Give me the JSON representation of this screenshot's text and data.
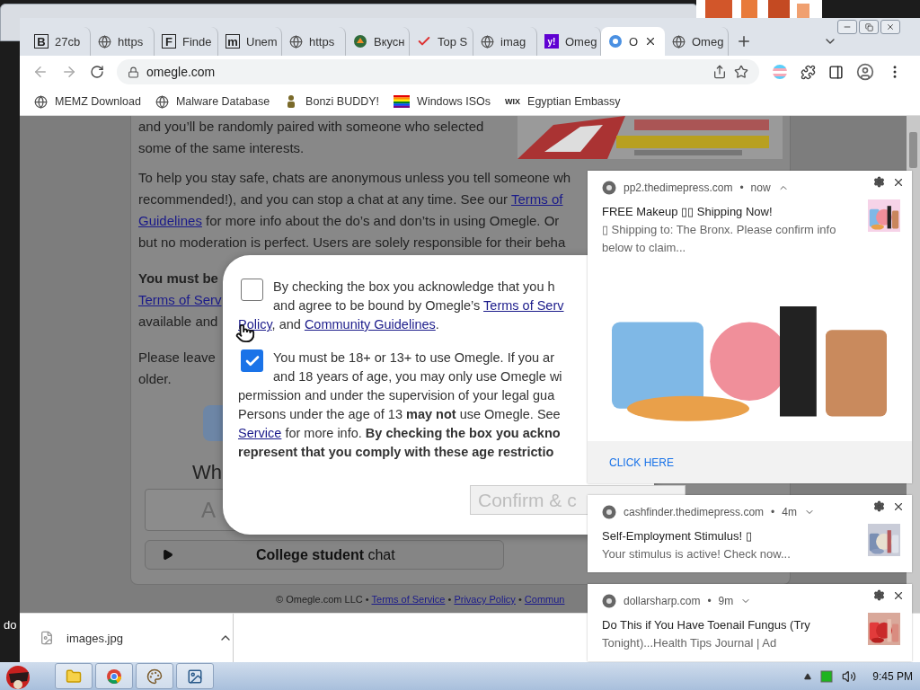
{
  "desktop": {
    "label": "do"
  },
  "browser": {
    "tabs": [
      {
        "icon": {
          "kind": "letter",
          "glyph": "B"
        },
        "title": "27cb",
        "selected": false
      },
      {
        "icon": {
          "kind": "globe"
        },
        "title": "https",
        "selected": false
      },
      {
        "icon": {
          "kind": "letter",
          "glyph": "F"
        },
        "title": "Finde",
        "selected": false
      },
      {
        "icon": {
          "kind": "letter",
          "glyph": "m"
        },
        "title": "Unem",
        "selected": false
      },
      {
        "icon": {
          "kind": "globe"
        },
        "title": "https",
        "selected": false
      },
      {
        "icon": {
          "kind": "dot"
        },
        "title": "Вкусн",
        "selected": false
      },
      {
        "icon": {
          "kind": "check"
        },
        "title": "Top S",
        "selected": false
      },
      {
        "icon": {
          "kind": "globe"
        },
        "title": "imag",
        "selected": false
      },
      {
        "icon": {
          "kind": "tile",
          "glyph": "y!"
        },
        "title": "Omeg",
        "selected": false
      },
      {
        "icon": {
          "kind": "app"
        },
        "title": "O",
        "selected": true
      },
      {
        "icon": {
          "kind": "globe"
        },
        "title": "Omeg",
        "selected": false
      }
    ],
    "address": "omegle.com",
    "bookmarks": [
      {
        "icon": {
          "kind": "globe"
        },
        "label": "MEMZ Download"
      },
      {
        "icon": {
          "kind": "globe"
        },
        "label": "Malware Database"
      },
      {
        "icon": {
          "kind": "figure"
        },
        "label": "Bonzi BUDDY!"
      },
      {
        "icon": {
          "kind": "rainbow"
        },
        "label": "Windows ISOs"
      },
      {
        "icon": {
          "kind": "wordmark",
          "glyph": "WIX"
        },
        "label": "Egyptian Embassy"
      }
    ]
  },
  "page": {
    "intro_lines": [
      [
        {
          "text": "and you’ll be randomly paired with someone who selected",
          "kind": "plain"
        }
      ],
      [
        {
          "text": "some of the same interests.",
          "kind": "plain"
        }
      ]
    ],
    "safety_lines": [
      [
        {
          "text": "To help you stay safe, chats are anonymous unless you tell someone wh",
          "kind": "plain"
        }
      ],
      [
        {
          "text": "recommended!), and you can stop a chat at any time. See our ",
          "kind": "plain"
        },
        {
          "text": "Terms of",
          "kind": "link"
        }
      ],
      [
        {
          "text": "Guidelines",
          "kind": "link"
        },
        {
          "text": " for more info about the do’s and don’ts in using Omegle. Or",
          "kind": "plain"
        }
      ],
      [
        {
          "text": "but no moderation is perfect. Users are solely responsible for their beha",
          "kind": "plain"
        }
      ]
    ],
    "age_lines": [
      [
        {
          "text": "You must be",
          "kind": "bold"
        }
      ],
      [
        {
          "text": "Terms of Serv",
          "kind": "link"
        }
      ],
      [
        {
          "text": "available and",
          "kind": "plain"
        }
      ]
    ],
    "leave_lines": [
      [
        {
          "text": "Please leave",
          "kind": "plain"
        }
      ],
      [
        {
          "text": "older.",
          "kind": "plain"
        }
      ]
    ],
    "heading": "Wh",
    "interests_placeholder": "A",
    "college_button": "**College student** chat",
    "footer": [
      {
        "text": "© Omegle.com LLC • ",
        "kind": "plain"
      },
      {
        "text": "Terms of Service",
        "kind": "link"
      },
      {
        "text": " • ",
        "kind": "plain"
      },
      {
        "text": "Privacy Policy",
        "kind": "link"
      },
      {
        "text": " • ",
        "kind": "plain"
      },
      {
        "text": "Commun",
        "kind": "link"
      }
    ]
  },
  "modal": {
    "items": [
      {
        "checked": false,
        "lines": [
          [
            {
              "text": "By checking the box you acknowledge that you h",
              "kind": "plain"
            }
          ],
          [
            {
              "text": "and agree to be bound by Omegle’s ",
              "kind": "plain"
            },
            {
              "text": "Terms of Serv",
              "kind": "link"
            }
          ],
          [
            {
              "text": "Policy",
              "kind": "link"
            },
            {
              "text": ", and ",
              "kind": "plain"
            },
            {
              "text": "Community Guidelines",
              "kind": "link"
            },
            {
              "text": ".",
              "kind": "plain"
            }
          ]
        ]
      },
      {
        "checked": true,
        "lines": [
          [
            {
              "text": "You must be 18+ or 13+ to use Omegle. If you ar",
              "kind": "plain"
            }
          ],
          [
            {
              "text": "and 18 years of age, you may only use Omegle wi",
              "kind": "plain"
            }
          ],
          [
            {
              "text": "permission and under the supervision of your legal gua",
              "kind": "plain"
            }
          ],
          [
            {
              "text": "Persons under the age of 13 ",
              "kind": "plain"
            },
            {
              "text": "may not",
              "kind": "bold"
            },
            {
              "text": " use Omegle. See",
              "kind": "plain"
            }
          ],
          [
            {
              "text": "Service",
              "kind": "link"
            },
            {
              "text": " for more info. ",
              "kind": "plain"
            },
            {
              "text": "By checking the box you ackno",
              "kind": "bold"
            }
          ],
          [
            {
              "text": "represent that you comply with these age restrictio",
              "kind": "bold"
            }
          ]
        ]
      }
    ],
    "confirm": {
      "label": "Confirm & c",
      "disabled": true
    }
  },
  "notifications": [
    {
      "site": "pp2.thedimepress.com",
      "separator": "•",
      "time": "now",
      "expanded": true,
      "title": "FREE Makeup ▯▯ Shipping Now!",
      "body": "▯ Shipping to: The Bronx. Please confirm info below to claim...",
      "action": "CLICK HERE"
    },
    {
      "site": "cashfinder.thedimepress.com",
      "separator": "•",
      "time": "4m",
      "expanded": false,
      "title": "Self-Employment Stimulus! ▯",
      "body": "Your stimulus is active! Check now..."
    },
    {
      "site": "dollarsharp.com",
      "separator": "•",
      "time": "9m",
      "expanded": false,
      "title": "Do This if You Have Toenail Fungus (Try",
      "body": "Tonight)...Health Tips Journal | Ad"
    }
  ],
  "downloads": [
    {
      "name": "images.jpg"
    }
  ],
  "taskbar": {
    "apps": [
      {
        "kind": "folder"
      },
      {
        "kind": "chrome"
      },
      {
        "kind": "paint"
      },
      {
        "kind": "viewer"
      }
    ],
    "time": "9:45 PM"
  }
}
